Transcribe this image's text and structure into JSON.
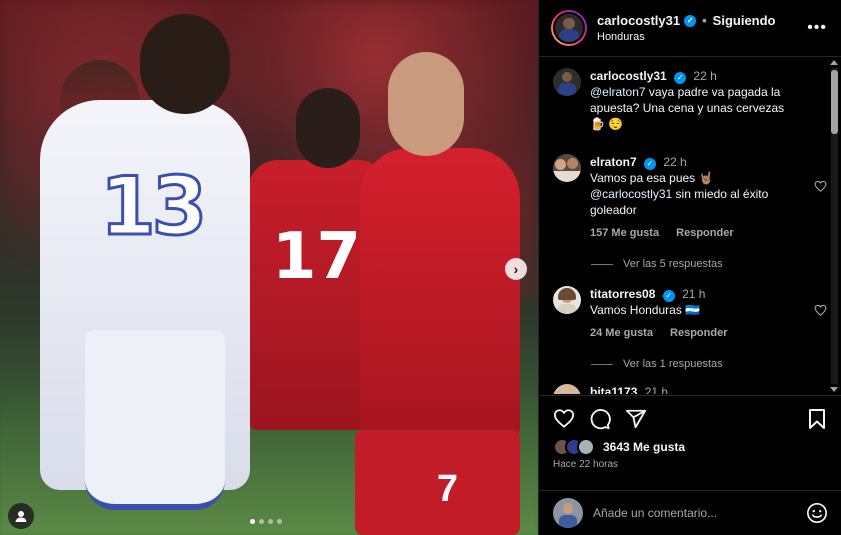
{
  "post": {
    "author": "carlocostly31",
    "location": "Honduras",
    "follow_status": "Siguiendo",
    "separator": "•",
    "more_label": "•••",
    "photo_numbers": {
      "white_jersey": "13",
      "red_back": "17",
      "red_shorts": "7"
    },
    "carousel": {
      "count": 4,
      "active_index": 0
    }
  },
  "comments": [
    {
      "user": "carlocostly31",
      "time": "22 h",
      "verified": true,
      "mention": "@elraton7",
      "text": " vaya padre va pagada la apuesta? Una cena y unas cervezas 🍺 😌"
    },
    {
      "user": "elraton7",
      "time": "22 h",
      "verified": true,
      "text_line1": "Vamos pa esa pues 🤘🏽",
      "mention": "@carlocostly31",
      "text_line2": " sin miedo al éxito goleador",
      "likes": "157 Me gusta",
      "reply": "Responder",
      "view_replies": "Ver las 5 respuestas"
    },
    {
      "user": "titatorres08",
      "time": "21 h",
      "verified": true,
      "text": "Vamos Honduras 🇭🇳",
      "likes": "24 Me gusta",
      "reply": "Responder",
      "view_replies": "Ver las 1 respuestas"
    },
    {
      "user": "bita1173",
      "time": "21 h"
    }
  ],
  "actions": {
    "likes": "3643 Me gusta",
    "time_ago": "Hace 22 horas"
  },
  "add_comment": {
    "placeholder": "Añade un comentario..."
  },
  "icons": {
    "like": "heart-icon",
    "comment": "comment-icon",
    "share": "share-icon",
    "save": "bookmark-icon",
    "emoji": "emoji-icon",
    "verified": "verified-badge-icon",
    "next": "chevron-right-icon",
    "tags": "user-tag-icon"
  },
  "colors": {
    "background": "#000000",
    "verified": "#0095f6",
    "secondary_text": "#a8a8a8",
    "mention": "#e0f1ff",
    "jersey_red": "#c81e2a",
    "jersey_blue_trim": "#3b4fb0"
  }
}
